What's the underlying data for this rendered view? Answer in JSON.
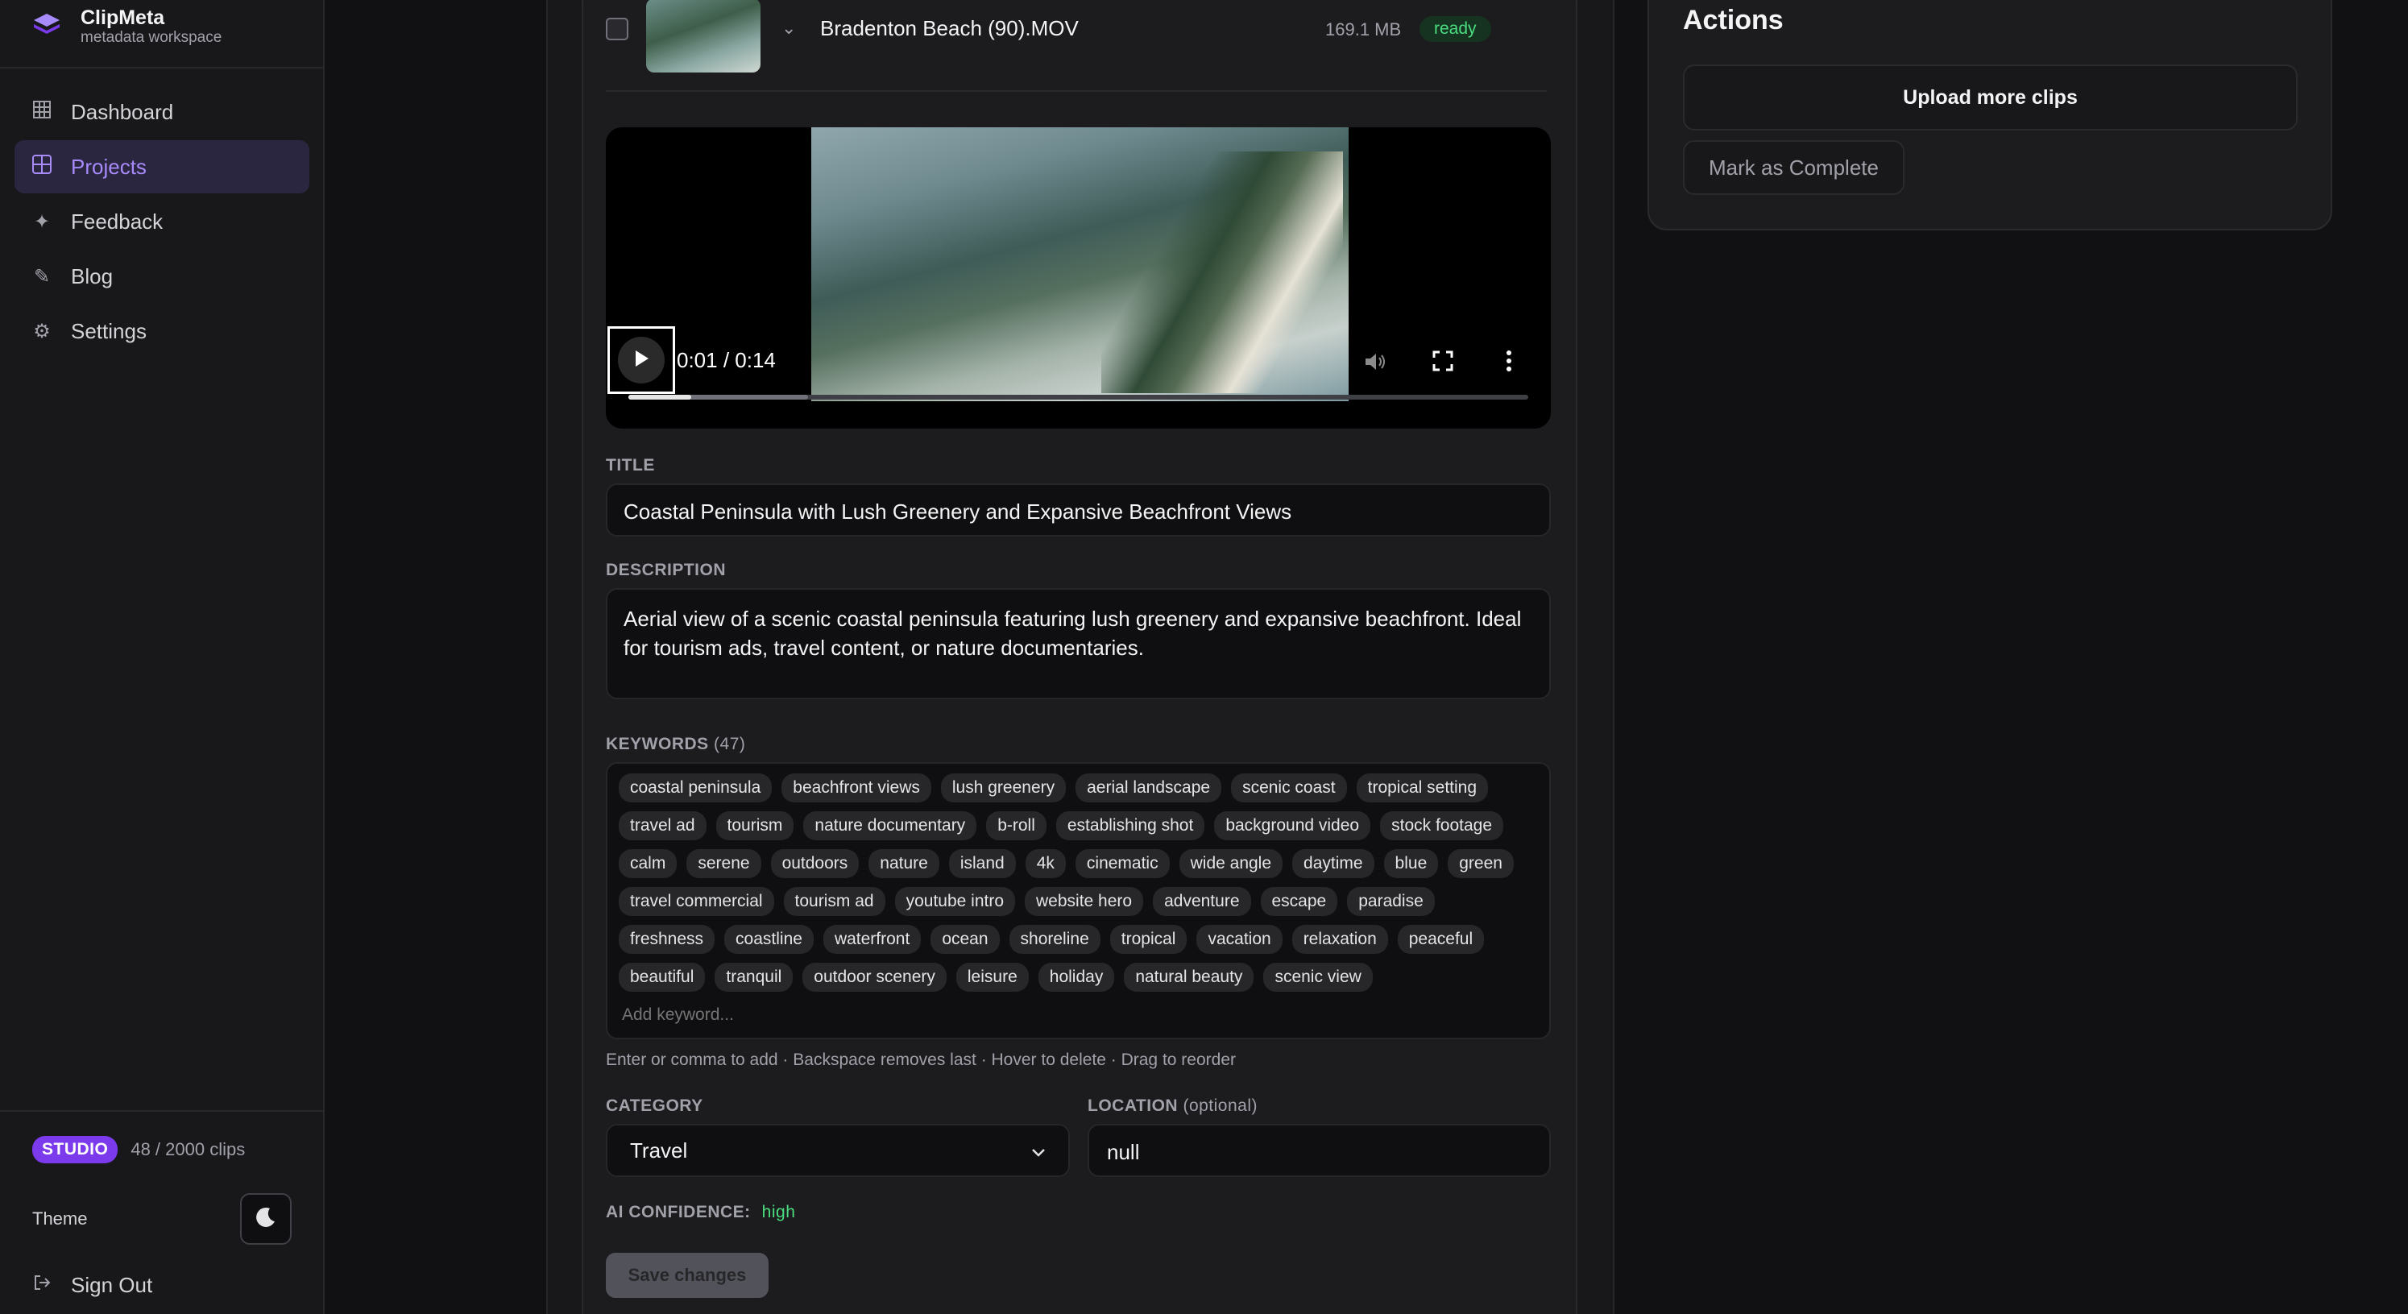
{
  "app": {
    "name": "ClipMeta",
    "tagline": "metadata workspace"
  },
  "sidebar": {
    "items": [
      {
        "label": "Dashboard",
        "icon": "grid-icon"
      },
      {
        "label": "Projects",
        "icon": "projects-icon",
        "active": true
      },
      {
        "label": "Feedback",
        "icon": "sparkle-icon"
      },
      {
        "label": "Blog",
        "icon": "pen-icon"
      },
      {
        "label": "Settings",
        "icon": "gear-icon"
      }
    ],
    "plan": {
      "badge": "STUDIO",
      "usage": "48 / 2000 clips"
    },
    "theme_label": "Theme",
    "theme_icon": "moon-icon",
    "sign_out": "Sign Out"
  },
  "clip": {
    "filename": "Bradenton Beach (90).MOV",
    "size": "169.1 MB",
    "status": "ready"
  },
  "video": {
    "time": "0:01 / 0:14",
    "played_fraction": 0.07,
    "buffered_fraction": 0.2
  },
  "form": {
    "title_label": "TITLE",
    "title_value": "Coastal Peninsula with Lush Greenery and Expansive Beachfront Views",
    "description_label": "DESCRIPTION",
    "description_value": "Aerial view of a scenic coastal peninsula featuring lush greenery and expansive beachfront. Ideal for tourism ads, travel content, or nature documentaries.",
    "keywords_label": "KEYWORDS",
    "keywords_count": "(47)",
    "keywords": [
      "coastal peninsula",
      "beachfront views",
      "lush greenery",
      "aerial landscape",
      "scenic coast",
      "tropical setting",
      "travel ad",
      "tourism",
      "nature documentary",
      "b-roll",
      "establishing shot",
      "background video",
      "stock footage",
      "calm",
      "serene",
      "outdoors",
      "nature",
      "island",
      "4k",
      "cinematic",
      "wide angle",
      "daytime",
      "blue",
      "green",
      "travel commercial",
      "tourism ad",
      "youtube intro",
      "website hero",
      "adventure",
      "escape",
      "paradise",
      "freshness",
      "coastline",
      "waterfront",
      "ocean",
      "shoreline",
      "tropical",
      "vacation",
      "relaxation",
      "peaceful",
      "beautiful",
      "tranquil",
      "outdoor scenery",
      "leisure",
      "holiday",
      "natural beauty",
      "scenic view"
    ],
    "keyword_placeholder": "Add keyword...",
    "keywords_help": "Enter or comma to add · Backspace removes last · Hover to delete · Drag to reorder",
    "category_label": "CATEGORY",
    "category_value": "Travel",
    "location_label": "LOCATION",
    "location_optional": "(optional)",
    "location_value": "null",
    "confidence_label": "AI CONFIDENCE:",
    "confidence_value": "high",
    "save_label": "Save changes"
  },
  "actions": {
    "title": "Actions",
    "upload_label": "Upload more clips",
    "complete_label": "Mark as Complete"
  }
}
